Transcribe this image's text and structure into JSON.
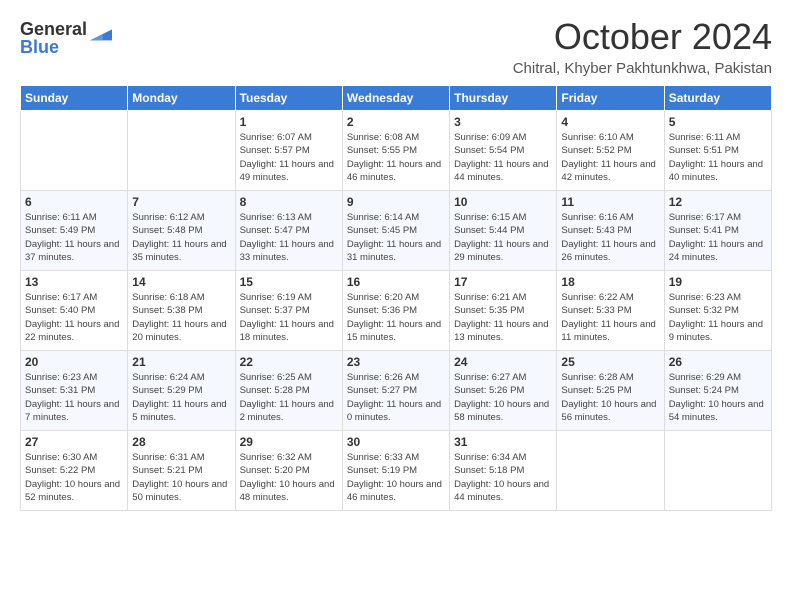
{
  "logo": {
    "general": "General",
    "blue": "Blue"
  },
  "header": {
    "month": "October 2024",
    "location": "Chitral, Khyber Pakhtunkhwa, Pakistan"
  },
  "days_of_week": [
    "Sunday",
    "Monday",
    "Tuesday",
    "Wednesday",
    "Thursday",
    "Friday",
    "Saturday"
  ],
  "weeks": [
    [
      {
        "day": "",
        "sunrise": "",
        "sunset": "",
        "daylight": ""
      },
      {
        "day": "",
        "sunrise": "",
        "sunset": "",
        "daylight": ""
      },
      {
        "day": "1",
        "sunrise": "Sunrise: 6:07 AM",
        "sunset": "Sunset: 5:57 PM",
        "daylight": "Daylight: 11 hours and 49 minutes."
      },
      {
        "day": "2",
        "sunrise": "Sunrise: 6:08 AM",
        "sunset": "Sunset: 5:55 PM",
        "daylight": "Daylight: 11 hours and 46 minutes."
      },
      {
        "day": "3",
        "sunrise": "Sunrise: 6:09 AM",
        "sunset": "Sunset: 5:54 PM",
        "daylight": "Daylight: 11 hours and 44 minutes."
      },
      {
        "day": "4",
        "sunrise": "Sunrise: 6:10 AM",
        "sunset": "Sunset: 5:52 PM",
        "daylight": "Daylight: 11 hours and 42 minutes."
      },
      {
        "day": "5",
        "sunrise": "Sunrise: 6:11 AM",
        "sunset": "Sunset: 5:51 PM",
        "daylight": "Daylight: 11 hours and 40 minutes."
      }
    ],
    [
      {
        "day": "6",
        "sunrise": "Sunrise: 6:11 AM",
        "sunset": "Sunset: 5:49 PM",
        "daylight": "Daylight: 11 hours and 37 minutes."
      },
      {
        "day": "7",
        "sunrise": "Sunrise: 6:12 AM",
        "sunset": "Sunset: 5:48 PM",
        "daylight": "Daylight: 11 hours and 35 minutes."
      },
      {
        "day": "8",
        "sunrise": "Sunrise: 6:13 AM",
        "sunset": "Sunset: 5:47 PM",
        "daylight": "Daylight: 11 hours and 33 minutes."
      },
      {
        "day": "9",
        "sunrise": "Sunrise: 6:14 AM",
        "sunset": "Sunset: 5:45 PM",
        "daylight": "Daylight: 11 hours and 31 minutes."
      },
      {
        "day": "10",
        "sunrise": "Sunrise: 6:15 AM",
        "sunset": "Sunset: 5:44 PM",
        "daylight": "Daylight: 11 hours and 29 minutes."
      },
      {
        "day": "11",
        "sunrise": "Sunrise: 6:16 AM",
        "sunset": "Sunset: 5:43 PM",
        "daylight": "Daylight: 11 hours and 26 minutes."
      },
      {
        "day": "12",
        "sunrise": "Sunrise: 6:17 AM",
        "sunset": "Sunset: 5:41 PM",
        "daylight": "Daylight: 11 hours and 24 minutes."
      }
    ],
    [
      {
        "day": "13",
        "sunrise": "Sunrise: 6:17 AM",
        "sunset": "Sunset: 5:40 PM",
        "daylight": "Daylight: 11 hours and 22 minutes."
      },
      {
        "day": "14",
        "sunrise": "Sunrise: 6:18 AM",
        "sunset": "Sunset: 5:38 PM",
        "daylight": "Daylight: 11 hours and 20 minutes."
      },
      {
        "day": "15",
        "sunrise": "Sunrise: 6:19 AM",
        "sunset": "Sunset: 5:37 PM",
        "daylight": "Daylight: 11 hours and 18 minutes."
      },
      {
        "day": "16",
        "sunrise": "Sunrise: 6:20 AM",
        "sunset": "Sunset: 5:36 PM",
        "daylight": "Daylight: 11 hours and 15 minutes."
      },
      {
        "day": "17",
        "sunrise": "Sunrise: 6:21 AM",
        "sunset": "Sunset: 5:35 PM",
        "daylight": "Daylight: 11 hours and 13 minutes."
      },
      {
        "day": "18",
        "sunrise": "Sunrise: 6:22 AM",
        "sunset": "Sunset: 5:33 PM",
        "daylight": "Daylight: 11 hours and 11 minutes."
      },
      {
        "day": "19",
        "sunrise": "Sunrise: 6:23 AM",
        "sunset": "Sunset: 5:32 PM",
        "daylight": "Daylight: 11 hours and 9 minutes."
      }
    ],
    [
      {
        "day": "20",
        "sunrise": "Sunrise: 6:23 AM",
        "sunset": "Sunset: 5:31 PM",
        "daylight": "Daylight: 11 hours and 7 minutes."
      },
      {
        "day": "21",
        "sunrise": "Sunrise: 6:24 AM",
        "sunset": "Sunset: 5:29 PM",
        "daylight": "Daylight: 11 hours and 5 minutes."
      },
      {
        "day": "22",
        "sunrise": "Sunrise: 6:25 AM",
        "sunset": "Sunset: 5:28 PM",
        "daylight": "Daylight: 11 hours and 2 minutes."
      },
      {
        "day": "23",
        "sunrise": "Sunrise: 6:26 AM",
        "sunset": "Sunset: 5:27 PM",
        "daylight": "Daylight: 11 hours and 0 minutes."
      },
      {
        "day": "24",
        "sunrise": "Sunrise: 6:27 AM",
        "sunset": "Sunset: 5:26 PM",
        "daylight": "Daylight: 10 hours and 58 minutes."
      },
      {
        "day": "25",
        "sunrise": "Sunrise: 6:28 AM",
        "sunset": "Sunset: 5:25 PM",
        "daylight": "Daylight: 10 hours and 56 minutes."
      },
      {
        "day": "26",
        "sunrise": "Sunrise: 6:29 AM",
        "sunset": "Sunset: 5:24 PM",
        "daylight": "Daylight: 10 hours and 54 minutes."
      }
    ],
    [
      {
        "day": "27",
        "sunrise": "Sunrise: 6:30 AM",
        "sunset": "Sunset: 5:22 PM",
        "daylight": "Daylight: 10 hours and 52 minutes."
      },
      {
        "day": "28",
        "sunrise": "Sunrise: 6:31 AM",
        "sunset": "Sunset: 5:21 PM",
        "daylight": "Daylight: 10 hours and 50 minutes."
      },
      {
        "day": "29",
        "sunrise": "Sunrise: 6:32 AM",
        "sunset": "Sunset: 5:20 PM",
        "daylight": "Daylight: 10 hours and 48 minutes."
      },
      {
        "day": "30",
        "sunrise": "Sunrise: 6:33 AM",
        "sunset": "Sunset: 5:19 PM",
        "daylight": "Daylight: 10 hours and 46 minutes."
      },
      {
        "day": "31",
        "sunrise": "Sunrise: 6:34 AM",
        "sunset": "Sunset: 5:18 PM",
        "daylight": "Daylight: 10 hours and 44 minutes."
      },
      {
        "day": "",
        "sunrise": "",
        "sunset": "",
        "daylight": ""
      },
      {
        "day": "",
        "sunrise": "",
        "sunset": "",
        "daylight": ""
      }
    ]
  ]
}
